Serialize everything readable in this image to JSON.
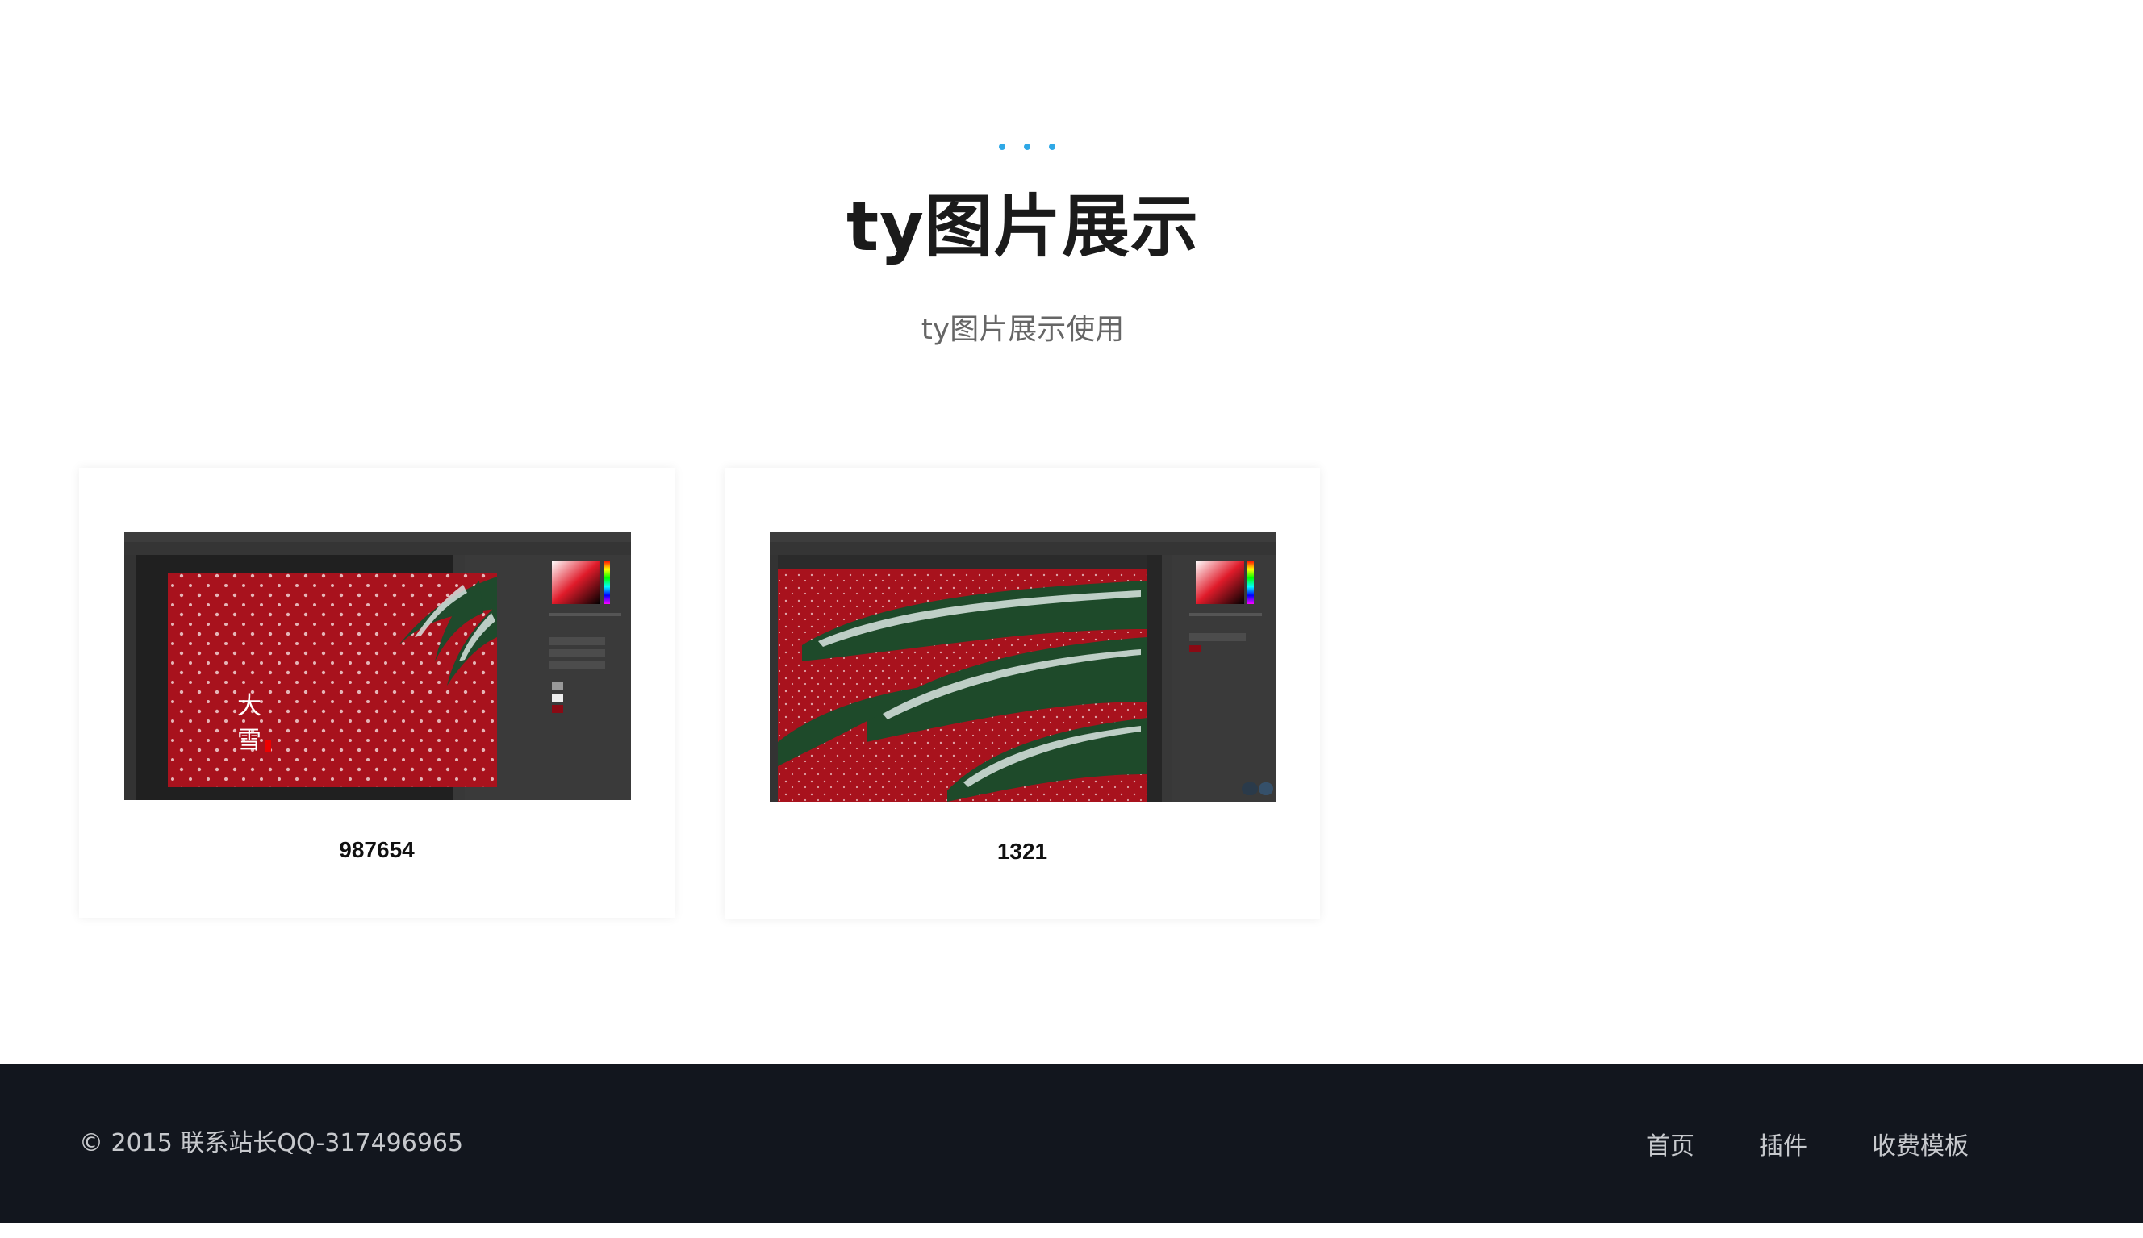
{
  "header": {
    "title": "ty图片展示",
    "subtitle": "ty图片展示使用",
    "accent_color": "#2fa8e6"
  },
  "cards": [
    {
      "caption": "987654",
      "thumbnail": "photoshop-screenshot-snow-pine-red",
      "overlay_text": "大雪"
    },
    {
      "caption": "1321",
      "thumbnail": "photoshop-screenshot-snow-pine-closeup"
    }
  ],
  "footer": {
    "copyright": "© 2015 联系站长QQ-317496965",
    "nav": [
      "首页",
      "插件",
      "收费模板"
    ],
    "background": "#12161e"
  }
}
